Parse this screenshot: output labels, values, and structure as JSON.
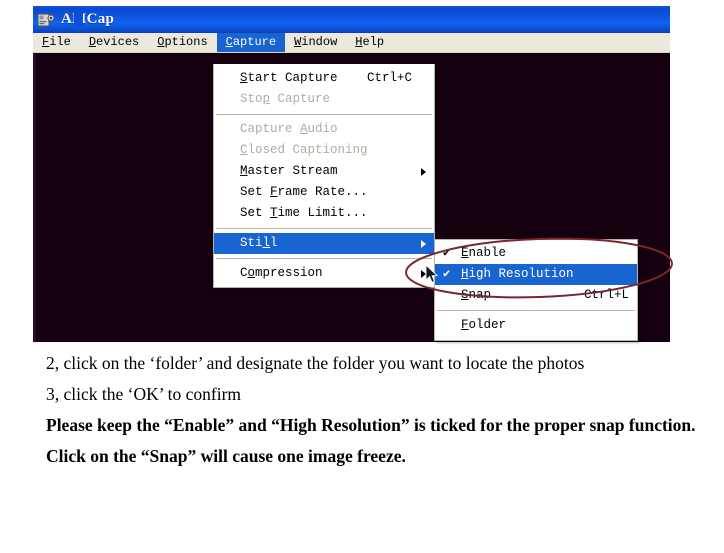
{
  "window": {
    "title": "AMCap",
    "icon": "camera-icon",
    "titlebar_color": "#0d52d8",
    "video_background": "#15000f"
  },
  "menubar": {
    "items": [
      {
        "label": "File",
        "mnemonic": "F",
        "active": false
      },
      {
        "label": "Devices",
        "mnemonic": "D",
        "active": false
      },
      {
        "label": "Options",
        "mnemonic": "O",
        "active": false
      },
      {
        "label": "Capture",
        "mnemonic": "C",
        "active": true
      },
      {
        "label": "Window",
        "mnemonic": "W",
        "active": false
      },
      {
        "label": "Help",
        "mnemonic": "H",
        "active": false
      }
    ]
  },
  "capture_menu": {
    "items": [
      {
        "label": "Start Capture",
        "mnemonic": "S",
        "accel": "Ctrl+C",
        "disabled": false,
        "submenu": false,
        "checked": false
      },
      {
        "label": "Stop Capture",
        "mnemonic": "p",
        "accel": "",
        "disabled": true,
        "submenu": false,
        "checked": false
      },
      {
        "separator": true
      },
      {
        "label": "Capture Audio",
        "mnemonic": "A",
        "accel": "",
        "disabled": true,
        "submenu": false,
        "checked": false
      },
      {
        "label": "Closed Captioning",
        "mnemonic": "C",
        "accel": "",
        "disabled": true,
        "submenu": false,
        "checked": false
      },
      {
        "label": "Master Stream",
        "mnemonic": "M",
        "accel": "",
        "disabled": false,
        "submenu": true,
        "checked": false
      },
      {
        "label": "Set Frame Rate...",
        "mnemonic": "F",
        "accel": "",
        "disabled": false,
        "submenu": false,
        "checked": false
      },
      {
        "label": "Set Time Limit...",
        "mnemonic": "T",
        "accel": "",
        "disabled": false,
        "submenu": false,
        "checked": false
      },
      {
        "separator": true
      },
      {
        "label": "Still",
        "mnemonic": "l",
        "accel": "",
        "disabled": false,
        "submenu": true,
        "checked": false,
        "selected": true
      },
      {
        "separator": true
      },
      {
        "label": "Compression",
        "mnemonic": "o",
        "accel": "",
        "disabled": false,
        "submenu": true,
        "checked": false
      }
    ]
  },
  "still_submenu": {
    "items": [
      {
        "label": "Enable",
        "mnemonic": "E",
        "accel": "",
        "checked": true,
        "selected": false
      },
      {
        "label": "High Resolution",
        "mnemonic": "H",
        "accel": "",
        "checked": true,
        "selected": true
      },
      {
        "label": "Snap",
        "mnemonic": "S",
        "accel": "Ctrl+L",
        "checked": false,
        "selected": false
      },
      {
        "separator": true
      },
      {
        "label": "Folder",
        "mnemonic": "F",
        "accel": "",
        "checked": false,
        "selected": false
      }
    ]
  },
  "annotation": {
    "shape": "ellipse",
    "color": "#7d2430",
    "target": "High Resolution"
  },
  "document": {
    "paragraphs": [
      {
        "text": "2, click on the ‘folder’ and designate the folder you want to locate the photos",
        "bold": false,
        "indent": true,
        "justify": true
      },
      {
        "text": "3, click the ‘OK’ to confirm",
        "bold": false,
        "indent": true,
        "justify": false
      },
      {
        "text": "Please keep the “Enable” and “High Resolution” is ticked for the proper snap function.",
        "bold": true,
        "indent": true,
        "justify": true
      },
      {
        "text": "Click on the “Snap” will cause one image freeze.",
        "bold": true,
        "indent": true,
        "justify": false
      }
    ]
  }
}
